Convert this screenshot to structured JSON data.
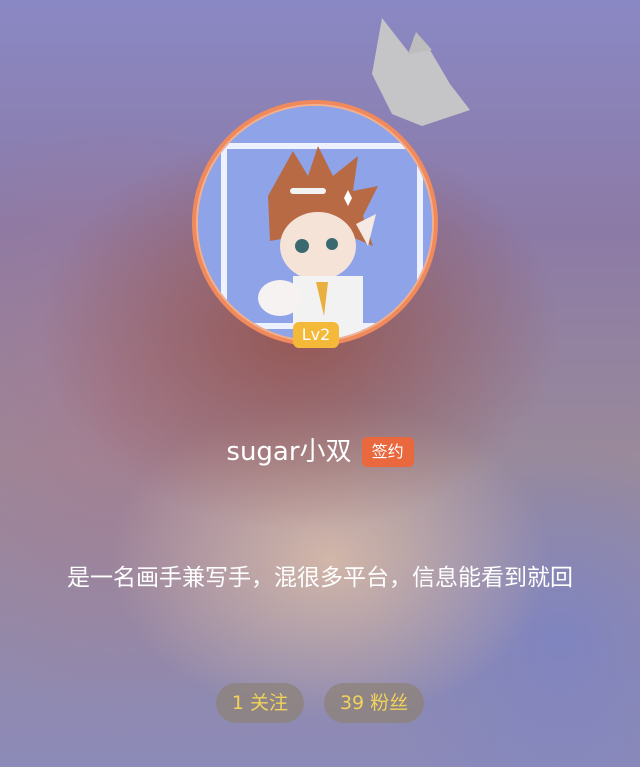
{
  "profile": {
    "username": "sugar小双",
    "signed_badge": "签约",
    "level": "Lv2",
    "bio": "是一名画手兼写手，混很多平台，信息能看到就回"
  },
  "stats": [
    {
      "value": "1",
      "label": "关注"
    },
    {
      "value": "39",
      "label": "粉丝"
    }
  ],
  "icons": {
    "crown": "crown-icon",
    "avatar": "avatar"
  },
  "colors": {
    "avatar_ring": "#f08a5d",
    "level_badge": "#f5b93a",
    "signed_badge": "#e9683e",
    "stat_text": "#f2d25a"
  }
}
